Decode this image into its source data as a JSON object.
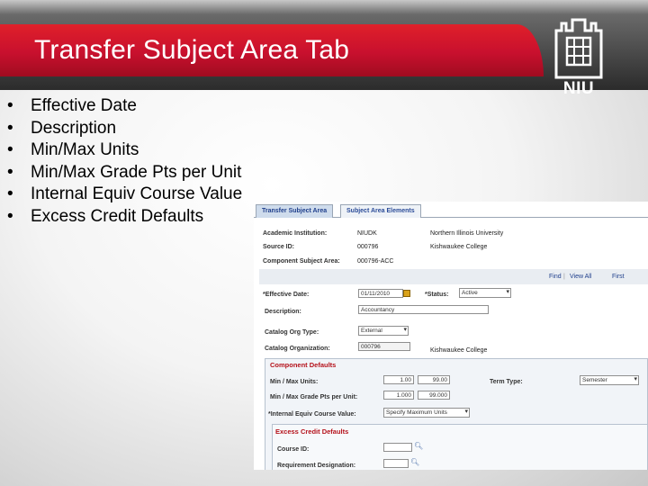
{
  "slide": {
    "title": "Transfer Subject Area Tab",
    "logo_text": "NIU",
    "bullet_char": "•",
    "bullets": [
      "Effective Date",
      "Description",
      "Min/Max Units",
      "Min/Max Grade Pts per Unit",
      "Internal Equiv Course Value",
      "Excess Credit Defaults"
    ]
  },
  "screen": {
    "tabs": [
      {
        "label": "Transfer Subject Area",
        "active": true
      },
      {
        "label": "Subject Area Elements",
        "active": false
      }
    ],
    "header": {
      "academic_institution_label": "Academic Institution:",
      "academic_institution_code": "NIUDK",
      "academic_institution_name": "Northern Illinois University",
      "source_id_label": "Source ID:",
      "source_id_code": "000796",
      "source_id_name": "Kishwaukee College",
      "component_subject_area_label": "Component Subject Area:",
      "component_subject_area_value": "000796-ACC"
    },
    "nav": {
      "find": "Find",
      "separator": "|",
      "view_all": "View All",
      "first": "First"
    },
    "form": {
      "effective_date_label": "*Effective Date:",
      "effective_date_value": "01/11/2010",
      "status_label": "*Status:",
      "status_value": "Active",
      "description_label": "Description:",
      "description_value": "Accountancy",
      "catalog_org_type_label": "Catalog Org Type:",
      "catalog_org_type_value": "External",
      "catalog_organization_label": "Catalog Organization:",
      "catalog_organization_value": "000796",
      "catalog_organization_name": "Kishwaukee College"
    },
    "component_defaults": {
      "title": "Component Defaults",
      "min_max_units_label": "Min / Max Units:",
      "min_units": "1.00",
      "max_units": "99.00",
      "term_type_label": "Term Type:",
      "term_type_value": "Semester",
      "min_max_grade_pts_label": "Min / Max Grade Pts per Unit:",
      "min_grade_pts": "1.000",
      "max_grade_pts": "99.000",
      "internal_equiv_label": "*Internal Equiv Course Value:",
      "internal_equiv_value": "Specify Maximum Units"
    },
    "excess_credit_defaults": {
      "title": "Excess Credit Defaults",
      "course_id_label": "Course ID:",
      "requirement_designation_label": "Requirement Designation:"
    }
  },
  "colors": {
    "banner_red": "#c8102e",
    "banner_dark": "#2b2b2b",
    "link_blue": "#1f3f8c",
    "group_title_red": "#b5121b"
  }
}
